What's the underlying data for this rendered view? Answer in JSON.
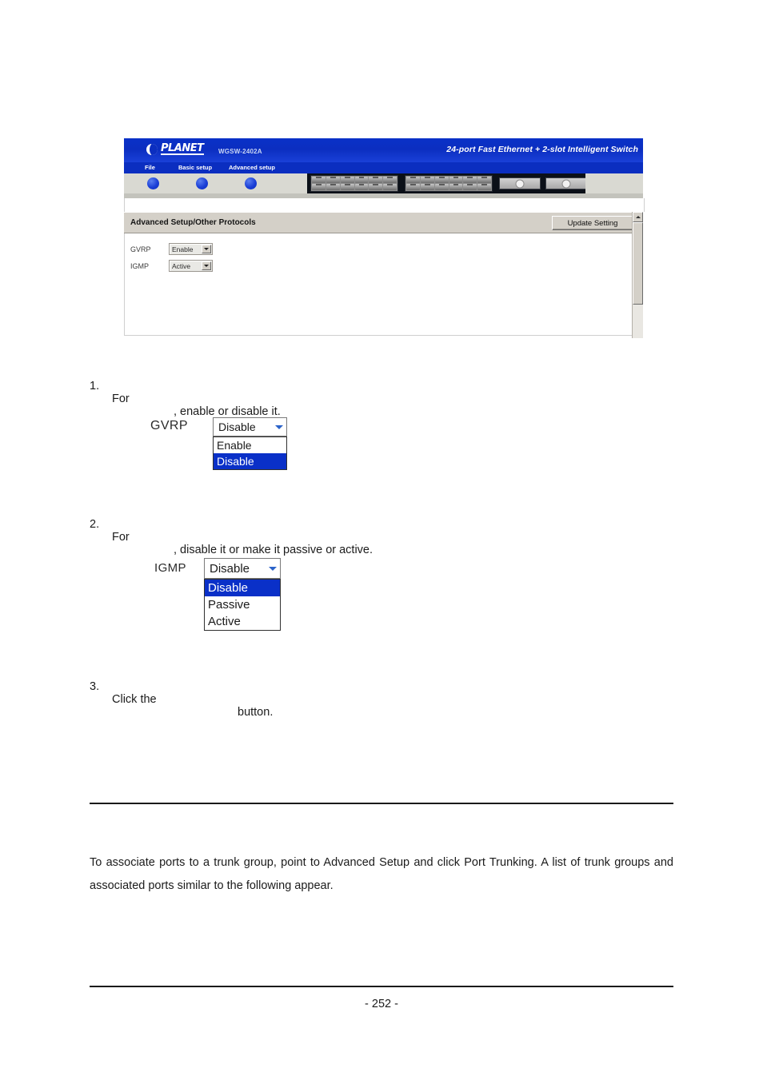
{
  "document": {
    "page_number_label": "- 252 -",
    "steps": [
      {
        "num": "1.",
        "lead": "For",
        "rest": ", enable or disable it."
      },
      {
        "num": "2.",
        "lead": "For",
        "rest": ", disable it or make it passive or active."
      },
      {
        "num": "3.",
        "lead": "Click the",
        "rest": "button."
      }
    ],
    "paragraph": "To associate ports to a trunk group, point to Advanced Setup and click Port Trunking. A list of trunk groups and associated ports similar to the following appear."
  },
  "app_screenshot": {
    "device": {
      "brand": "PLANET",
      "model": "WGSW-2402A",
      "tagline": "24-port Fast Ethernet + 2-slot Intelligent Switch",
      "menu": [
        "File",
        "Basic setup",
        "Advanced setup"
      ],
      "port_block_count": 2,
      "ports_per_block": 12,
      "module_slots": 2
    },
    "panel": {
      "title": "Advanced Setup/Other Protocols",
      "update_button": "Update Setting"
    },
    "fields": [
      {
        "label": "GVRP",
        "value": "Enable"
      },
      {
        "label": "IGMP",
        "value": "Active"
      }
    ],
    "scrollbar": {
      "up_arrow_icon": "triangle-up-icon"
    }
  },
  "figure_gvrp": {
    "label": "GVRP",
    "selected": "Disable",
    "options": [
      "Enable",
      "Disable"
    ],
    "highlighted": "Disable",
    "highlight_color": "#0a30c8",
    "arrow_icon": "chevron-down-icon"
  },
  "figure_igmp": {
    "label": "IGMP",
    "selected": "Disable",
    "options": [
      "Disable",
      "Passive",
      "Active"
    ],
    "highlighted": "Disable",
    "highlight_color": "#0a30c8",
    "arrow_icon": "chevron-down-icon"
  }
}
